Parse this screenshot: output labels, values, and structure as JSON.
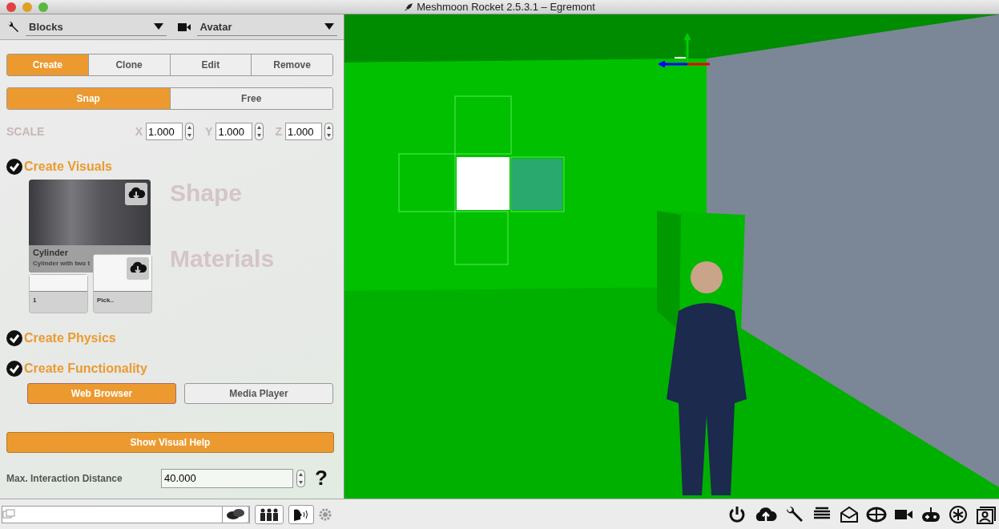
{
  "window": {
    "title": "Meshmoon Rocket 2.5.3.1 – Egremont"
  },
  "toolbar": {
    "tool_dropdown": {
      "value": "Blocks"
    },
    "camera_dropdown": {
      "value": "Avatar"
    }
  },
  "mode_tabs": [
    {
      "label": "Create",
      "selected": true
    },
    {
      "label": "Clone",
      "selected": false
    },
    {
      "label": "Edit",
      "selected": false
    },
    {
      "label": "Remove",
      "selected": false
    }
  ],
  "placement_tabs": [
    {
      "label": "Snap",
      "selected": true
    },
    {
      "label": "Free",
      "selected": false
    }
  ],
  "scale": {
    "label": "SCALE",
    "axes": [
      {
        "label": "X",
        "value": "1.000"
      },
      {
        "label": "Y",
        "value": "1.000"
      },
      {
        "label": "Z",
        "value": "1.000"
      }
    ]
  },
  "visuals": {
    "title": "Create Visuals",
    "checked": true,
    "shape_label": "Shape",
    "materials_label": "Materials",
    "shape_card": {
      "title": "Cylinder",
      "description": "Cylinder with two t"
    },
    "material_cards": [
      {
        "label": "1"
      },
      {
        "label": "Pick.."
      }
    ]
  },
  "physics": {
    "title": "Create Physics",
    "checked": true
  },
  "functionality": {
    "title": "Create Functionality",
    "checked": true,
    "options": [
      {
        "label": "Web Browser",
        "selected": true
      },
      {
        "label": "Media Player",
        "selected": false
      }
    ]
  },
  "help_button": "Show Visual Help",
  "distance": {
    "label": "Max. Interaction Distance",
    "value": "40.000",
    "help": "?"
  }
}
